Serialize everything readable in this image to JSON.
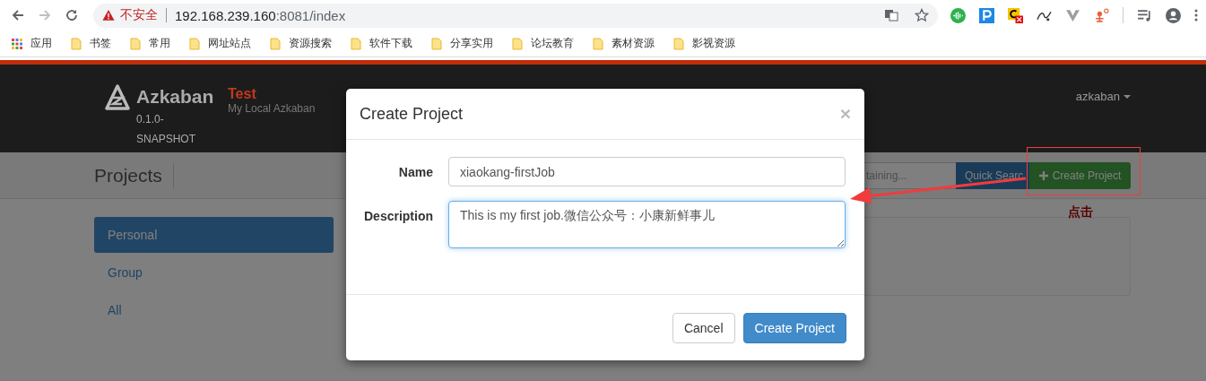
{
  "browser": {
    "security": "不安全",
    "host": "192.168.239.160",
    "path": ":8081/index",
    "bookmarks": [
      {
        "kind": "apps",
        "label": "应用"
      },
      {
        "kind": "folder",
        "label": "书签"
      },
      {
        "kind": "folder",
        "label": "常用"
      },
      {
        "kind": "folder",
        "label": "网址站点"
      },
      {
        "kind": "folder",
        "label": "资源搜索"
      },
      {
        "kind": "folder",
        "label": "软件下载"
      },
      {
        "kind": "folder",
        "label": "分享实用"
      },
      {
        "kind": "folder",
        "label": "论坛教育"
      },
      {
        "kind": "folder",
        "label": "素材资源"
      },
      {
        "kind": "folder",
        "label": "影视资源"
      }
    ]
  },
  "navbar": {
    "brand": "Azkaban",
    "version": "0.1.0-SNAPSHOT",
    "env": "Test",
    "env_subtitle": "My Local Azkaban",
    "user": "azkaban"
  },
  "page": {
    "title": "Projects",
    "search_placeholder": "taining...",
    "search_button": "Quick Searc",
    "create_button": "Create Project",
    "sidebar": [
      {
        "label": "Personal",
        "selected": true
      },
      {
        "label": "Group",
        "selected": false
      },
      {
        "label": "All",
        "selected": false
      }
    ]
  },
  "modal": {
    "title": "Create Project",
    "close": "×",
    "fields": [
      {
        "kind": "input",
        "label": "Name",
        "value": "xiaokang-firstJob",
        "focused": false
      },
      {
        "kind": "textarea",
        "label": "Description",
        "value": "This is my first job.微信公众号：小康新鲜事儿",
        "focused": true
      }
    ],
    "buttons": [
      {
        "label": "Cancel",
        "primary": false
      },
      {
        "label": "Create Project",
        "primary": true
      }
    ]
  },
  "annotation": {
    "label": "点击"
  }
}
